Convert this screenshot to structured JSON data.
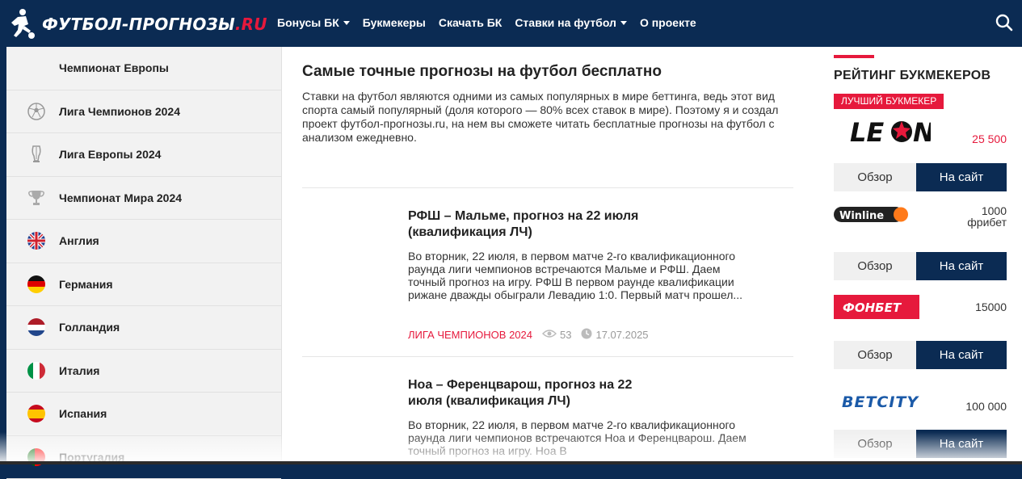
{
  "header": {
    "logo_main": "ФУТБОЛ-ПРОГНОЗЫ",
    "logo_suffix": ".RU",
    "nav": [
      {
        "label": "Бонусы БК",
        "dropdown": true
      },
      {
        "label": "Букмекеры",
        "dropdown": false
      },
      {
        "label": "Скачать БК",
        "dropdown": false
      },
      {
        "label": "Ставки на футбол",
        "dropdown": true
      },
      {
        "label": "О проекте",
        "dropdown": false
      }
    ],
    "search_icon": "search-icon"
  },
  "sidebar": {
    "items": [
      {
        "label": "Чемпионат Европы",
        "icon": "none"
      },
      {
        "label": "Лига Чемпионов 2024",
        "icon": "ball-icon"
      },
      {
        "label": "Лига Европы 2024",
        "icon": "europa-cup-icon"
      },
      {
        "label": "Чемпионат Мира 2024",
        "icon": "world-cup-icon"
      },
      {
        "label": "Англия",
        "icon": "uk-flag-icon"
      },
      {
        "label": "Германия",
        "icon": "germany-flag-icon"
      },
      {
        "label": "Голландия",
        "icon": "netherlands-flag-icon"
      },
      {
        "label": "Италия",
        "icon": "italy-flag-icon"
      },
      {
        "label": "Испания",
        "icon": "spain-flag-icon"
      },
      {
        "label": "Португалия",
        "icon": "portugal-flag-icon"
      }
    ]
  },
  "main": {
    "title": "Самые точные прогнозы на футбол бесплатно",
    "intro": "Ставки на футбол являются одними из самых популярных в мире беттинга, ведь этот вид спорта самый популярный (доля которого — 80% всех ставок в мире). Поэтому я и создал проект футбол-прогнозы.ru, на нем вы сможете читать бесплатные прогнозы на футбол с анализом ежедневно.",
    "articles": [
      {
        "title": "РФШ – Мальме, прогноз на 22 июля (квалификация ЛЧ)",
        "excerpt": "Во вторник, 22 июля, в первом матче 2-го квалификационного раунда лиги чемпионов встречаются Мальме и РФШ. Даем точный прогноз на игру. РФШ В первом раунде квалификации рижане дважды обыграли Левадию 1:0. Первый матч прошел...",
        "category": "Лига Чемпионов 2024",
        "views": "53",
        "date": "17.07.2025"
      },
      {
        "title": "Ноа – Ференцварош, прогноз на 22 июля (квалификация ЛЧ)",
        "excerpt": "Во вторник, 22 июля, в первом матче 2-го квалификационного раунда лиги чемпионов встречаются Ноа и Ференцварош. Даем точный прогноз на игру. Ноа В"
      }
    ]
  },
  "rail": {
    "title": "РЕЙТИНГ БУКМЕКЕРОВ",
    "best_badge": "ЛУЧШИЙ БУКМЕКЕР",
    "review_label": "Обзор",
    "site_label": "На сайт",
    "bookmakers": [
      {
        "name": "LEON",
        "bonus": "25 500",
        "accent": "#e6193c"
      },
      {
        "name": "Winline",
        "bonus": "1000 фрибет",
        "accent": "#ff7a1a"
      },
      {
        "name": "ФОНБЕТ",
        "bonus": "15000",
        "accent": "#e6193c"
      },
      {
        "name": "BETCITY",
        "bonus": "100 000",
        "accent": "#1b5aa8"
      }
    ]
  },
  "colors": {
    "navy": "#0b2b53",
    "red": "#e6193c"
  }
}
